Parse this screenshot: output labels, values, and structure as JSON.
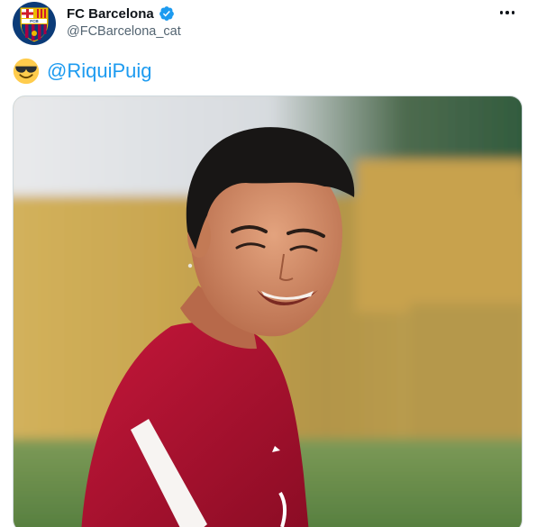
{
  "tweet": {
    "author": {
      "display_name": "FC Barcelona",
      "handle": "@FCBarcelona_cat",
      "verified": true,
      "avatar_icon": "fc-barcelona-crest-icon",
      "crest_text": "FCB"
    },
    "text": {
      "emoji": "smiling-face-with-sunglasses-icon",
      "mention": "@RiquiPuig"
    },
    "more_icon": "more-options-icon",
    "media": {
      "type": "photo",
      "icon": "player-photo"
    }
  },
  "colors": {
    "accent": "#1d9bf0",
    "name_text": "#0f1419",
    "handle_text": "#536471",
    "border": "#cfd9de",
    "jersey": "#b0122b",
    "crest_blue": "#0b3b78",
    "crest_red": "#a50044",
    "crest_gold": "#edbb00"
  }
}
